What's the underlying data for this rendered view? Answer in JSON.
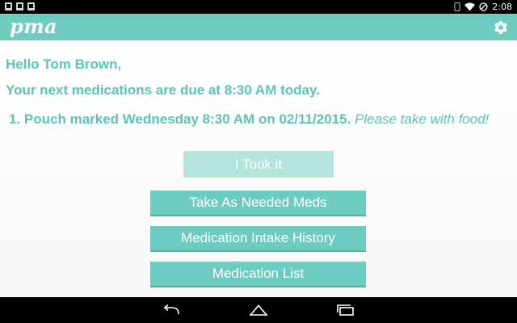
{
  "status_bar": {
    "time": "2:08",
    "icons": [
      "notification-icon",
      "photo-icon",
      "photo-icon",
      "vibrate-icon",
      "wifi-icon",
      "block-icon"
    ]
  },
  "app_bar": {
    "logo": "pma",
    "settings_icon": "gear-icon",
    "color": "#6dcbbf"
  },
  "content": {
    "greeting": "Hello Tom Brown,",
    "next_due": "Your next medications are due at 8:30 AM today.",
    "pouch": {
      "number": "1.",
      "text": "Pouch marked Wednesday 8:30 AM on 02/11/2015.",
      "note": "Please take with food!"
    }
  },
  "buttons": {
    "took_it": "I Took it",
    "as_needed": "Take As Needed Meds",
    "intake_history": "Medication Intake History",
    "med_list": "Medication List"
  },
  "nav_bar": {
    "back_icon": "back-icon",
    "home_icon": "home-icon",
    "recents_icon": "recents-icon"
  },
  "colors": {
    "accent": "#6dcbbf",
    "text": "#5ec2b6",
    "disabled_button": "#b3e5dd"
  }
}
